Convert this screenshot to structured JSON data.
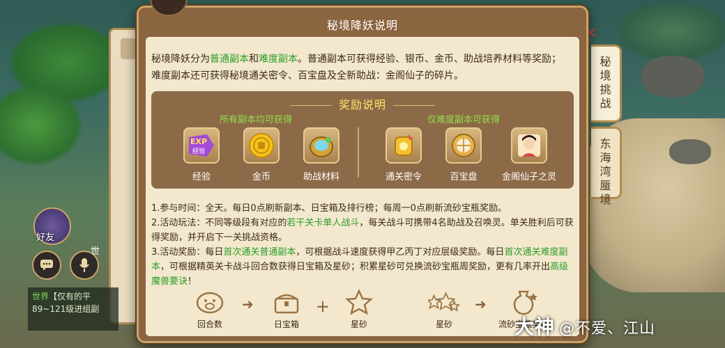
{
  "dialog": {
    "title": "秘境降妖说明",
    "intro": {
      "p1": "秘境降妖分为",
      "normal": "普通副本",
      "and": "和",
      "hard": "难度副本",
      "p2": "。普通副本可获得经验、银币、金币、助战培养材料等奖励；难度副本还可获得秘境通关密令、百宝盘及全新助战：金阁仙子的碎片。"
    },
    "rewards": {
      "title": "奖励说明",
      "all_label": "所有副本均可获得",
      "hard_label": "仅难度副本可获得",
      "all_items": [
        {
          "label": "经验",
          "icon": "exp-icon",
          "badge": "EXP",
          "badge_sub": "经验"
        },
        {
          "label": "金币",
          "icon": "gold-coin-icon"
        },
        {
          "label": "助战材料",
          "icon": "assist-material-icon"
        }
      ],
      "hard_items": [
        {
          "label": "通关密令",
          "icon": "pass-token-icon"
        },
        {
          "label": "百宝盘",
          "icon": "treasure-plate-icon"
        },
        {
          "label": "金阁仙子之灵",
          "icon": "fairy-portrait-icon"
        }
      ]
    },
    "rules": {
      "r1": "1.参与时间：全天。每日0点刷新副本、日宝箱及排行榜；每周一0点刷新流砂宝瓶奖励。",
      "r2a": "2.活动玩法：不同等级段有对应的",
      "r2b": "若干关卡单人战斗",
      "r2c": "，每关战斗可携带4名助战及召唤灵。单关胜利后可获得奖励，并开启下一关挑战资格。",
      "r3a": "3.活动奖励：每日",
      "r3b": "首次通关普通副本",
      "r3c": "，可根据战斗速度获得甲乙丙丁对应层级奖励。每日",
      "r3d": "首次通关难度副本",
      "r3e": "，可根据精英关卡战斗回合数获得日宝箱及星砂；积累星砂可兑换流砂宝瓶周奖励，更有几率开出",
      "r3f": "高级魔兽要诀",
      "r3g": "！"
    },
    "flow": [
      {
        "label": "回合数",
        "icon": "pig-icon"
      },
      {
        "label": "日宝箱",
        "icon": "chest-icon"
      },
      {
        "label": "星砂",
        "icon": "star-sand-icon"
      },
      {
        "label": "星砂",
        "icon": "star-sand-pile-icon"
      },
      {
        "label": "流砂宝瓶奖励",
        "icon": "sand-vase-icon"
      }
    ]
  },
  "tabs": [
    {
      "label": "秘境挑战",
      "active": true
    },
    {
      "label": "东海湾蜃境",
      "active": false
    }
  ],
  "side": {
    "friend_label": "好友",
    "world_label": "世",
    "chat_tag": "世界",
    "chat_line1": "【仅有的平",
    "chat_line2": "89~121级进组副"
  },
  "watermark": {
    "brand": "大神",
    "user": "@不爱、江山"
  },
  "colors": {
    "highlight_green": "#2a9e2a",
    "reward_title": "#ffe66b",
    "subhead": "#8fe04a"
  }
}
